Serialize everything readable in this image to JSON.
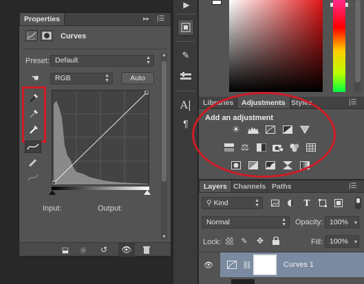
{
  "colors": {
    "accent_red": "#d11c26",
    "panel": "#535353",
    "selection": "#7a8aa0"
  },
  "properties": {
    "title": "Properties",
    "panel_label": "Curves",
    "preset_label": "Preset:",
    "preset_value": "Default",
    "channel_value": "RGB",
    "auto_label": "Auto",
    "input_label": "Input:",
    "output_label": "Output:"
  },
  "upper_tabs": {
    "libraries": "Libraries",
    "adjustments": "Adjustments",
    "styles": "Styles"
  },
  "adjustments": {
    "heading": "Add an adjustment"
  },
  "lower_tabs": {
    "layers": "Layers",
    "channels": "Channels",
    "paths": "Paths"
  },
  "layers": {
    "filter_value": "Kind",
    "blend_mode": "Normal",
    "opacity_label": "Opacity:",
    "opacity_value": "100%",
    "lock_label": "Lock:",
    "fill_label": "Fill:",
    "fill_value": "100%",
    "layer_name": "Curves 1"
  }
}
